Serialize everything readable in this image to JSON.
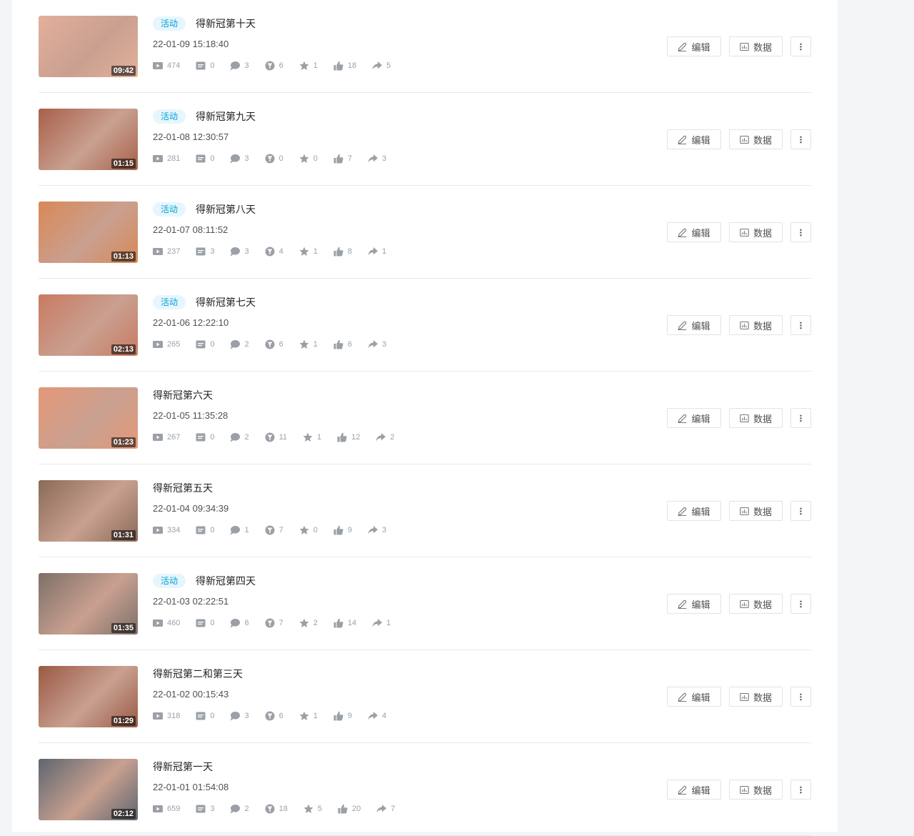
{
  "actions": {
    "edit_label": "编辑",
    "data_label": "数据"
  },
  "videos": [
    {
      "tag": "活动",
      "title": "得新冠第十天",
      "time": "22-01-09 15:18:40",
      "duration": "09:42",
      "plays": "474",
      "danmaku": "0",
      "comments": "3",
      "coins": "6",
      "favorites": "1",
      "likes": "18",
      "shares": "5",
      "thumb_color": "#e3b09b"
    },
    {
      "tag": "活动",
      "title": "得新冠第九天",
      "time": "22-01-08 12:30:57",
      "duration": "01:15",
      "plays": "281",
      "danmaku": "0",
      "comments": "3",
      "coins": "0",
      "favorites": "0",
      "likes": "7",
      "shares": "3",
      "thumb_color": "#a8614a"
    },
    {
      "tag": "活动",
      "title": "得新冠第八天",
      "time": "22-01-07 08:11:52",
      "duration": "01:13",
      "plays": "237",
      "danmaku": "3",
      "comments": "3",
      "coins": "4",
      "favorites": "1",
      "likes": "8",
      "shares": "1",
      "thumb_color": "#d98856"
    },
    {
      "tag": "活动",
      "title": "得新冠第七天",
      "time": "22-01-06 12:22:10",
      "duration": "02:13",
      "plays": "265",
      "danmaku": "0",
      "comments": "2",
      "coins": "6",
      "favorites": "1",
      "likes": "6",
      "shares": "3",
      "thumb_color": "#c97a62"
    },
    {
      "tag": "",
      "title": "得新冠第六天",
      "time": "22-01-05 11:35:28",
      "duration": "01:23",
      "plays": "267",
      "danmaku": "0",
      "comments": "2",
      "coins": "11",
      "favorites": "1",
      "likes": "12",
      "shares": "2",
      "thumb_color": "#e49878"
    },
    {
      "tag": "",
      "title": "得新冠第五天",
      "time": "22-01-04 09:34:39",
      "duration": "01:31",
      "plays": "334",
      "danmaku": "0",
      "comments": "1",
      "coins": "7",
      "favorites": "0",
      "likes": "9",
      "shares": "3",
      "thumb_color": "#8a6a58"
    },
    {
      "tag": "活动",
      "title": "得新冠第四天",
      "time": "22-01-03 02:22:51",
      "duration": "01:35",
      "plays": "460",
      "danmaku": "0",
      "comments": "6",
      "coins": "7",
      "favorites": "2",
      "likes": "14",
      "shares": "1",
      "thumb_color": "#7d7068"
    },
    {
      "tag": "",
      "title": "得新冠第二和第三天",
      "time": "22-01-02 00:15:43",
      "duration": "01:29",
      "plays": "318",
      "danmaku": "0",
      "comments": "3",
      "coins": "6",
      "favorites": "1",
      "likes": "9",
      "shares": "4",
      "thumb_color": "#9a5a44"
    },
    {
      "tag": "",
      "title": "得新冠第一天",
      "time": "22-01-01 01:54:08",
      "duration": "02:12",
      "plays": "659",
      "danmaku": "3",
      "comments": "2",
      "coins": "18",
      "favorites": "5",
      "likes": "20",
      "shares": "7",
      "thumb_color": "#5d6670"
    }
  ]
}
